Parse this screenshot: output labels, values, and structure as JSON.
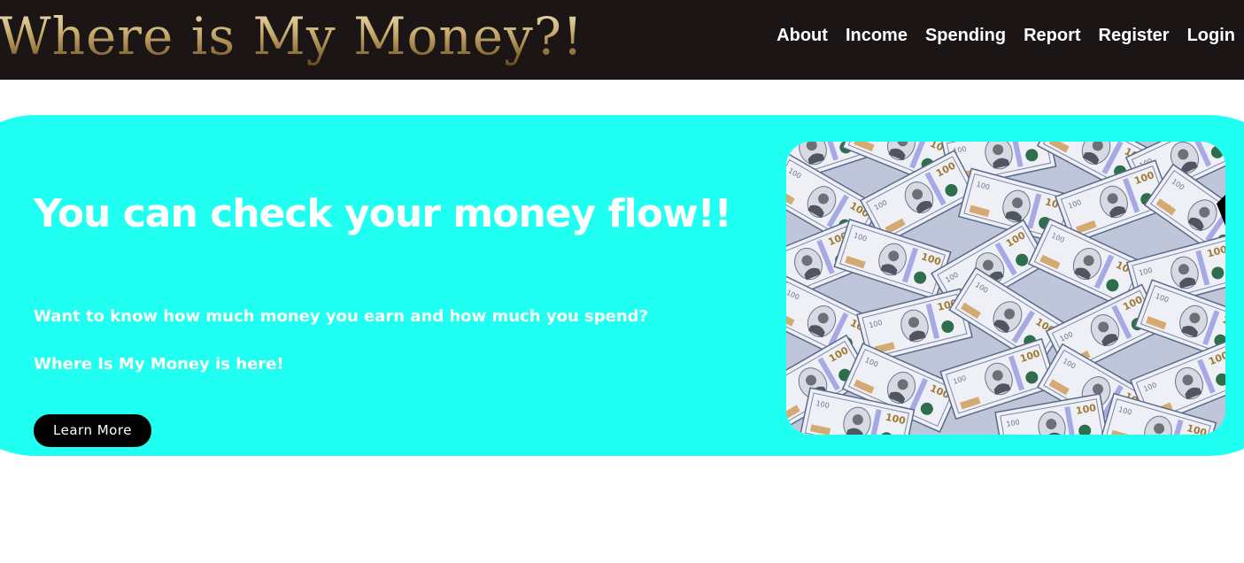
{
  "header": {
    "logo_text": "Where is My Money?!",
    "nav": [
      {
        "label": "About"
      },
      {
        "label": "Income"
      },
      {
        "label": "Spending"
      },
      {
        "label": "Report"
      },
      {
        "label": "Register"
      },
      {
        "label": "Login"
      }
    ]
  },
  "hero": {
    "headline": "You can check your money flow!!",
    "paragraph_1": "Want to know how much money you earn and how much you spend?",
    "paragraph_2": "Where Is My Money is here!",
    "cta_label": "Learn More",
    "image_subject": "pile of hundred dollar bills"
  },
  "colors": {
    "header_bg": "#1b1515",
    "hero_bg": "#1ffff2",
    "logo_gold": "#c7ab6d",
    "button_bg": "#000000",
    "text_white": "#ffffff"
  }
}
